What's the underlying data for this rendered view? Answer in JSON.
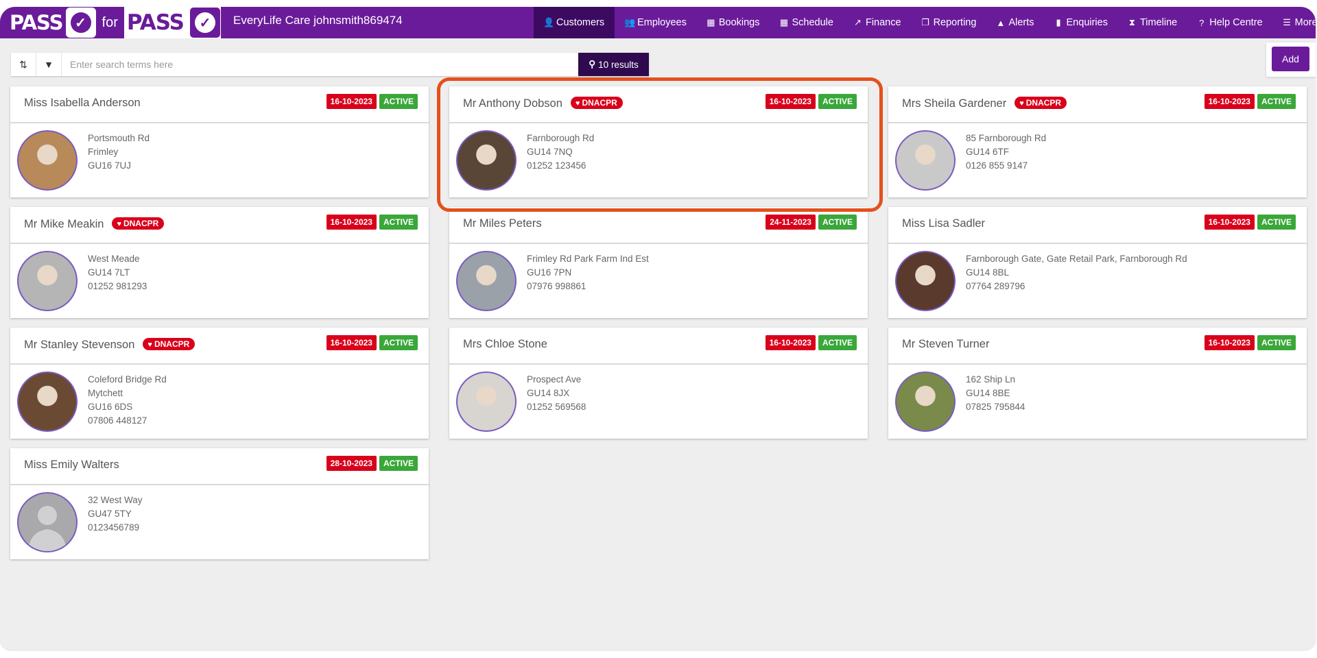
{
  "app": {
    "logo_left": "PASS",
    "logo_for": "for",
    "logo_right": "PASS",
    "organisation": "EveryLife Care johnsmith869474"
  },
  "nav": {
    "items": [
      {
        "label": "Customers",
        "icon": "user-icon",
        "glyph": "👤",
        "active": true
      },
      {
        "label": "Employees",
        "icon": "users-icon",
        "glyph": "👥",
        "active": false
      },
      {
        "label": "Bookings",
        "icon": "calendar-icon",
        "glyph": "▦",
        "active": false
      },
      {
        "label": "Schedule",
        "icon": "calendar-icon",
        "glyph": "▦",
        "active": false
      },
      {
        "label": "Finance",
        "icon": "line-chart-icon",
        "glyph": "↗",
        "active": false
      },
      {
        "label": "Reporting",
        "icon": "copy-icon",
        "glyph": "❐",
        "active": false
      },
      {
        "label": "Alerts",
        "icon": "warning-icon",
        "glyph": "▲",
        "active": false
      },
      {
        "label": "Enquiries",
        "icon": "document-icon",
        "glyph": "▮",
        "active": false
      },
      {
        "label": "Timeline",
        "icon": "hourglass-icon",
        "glyph": "⧗",
        "active": false
      },
      {
        "label": "Help Centre",
        "icon": "help-icon",
        "glyph": "?",
        "active": false
      },
      {
        "label": "More",
        "icon": "menu-icon",
        "glyph": "☰",
        "active": false
      }
    ]
  },
  "search": {
    "placeholder": "Enter search terms here",
    "value": "",
    "sort_icon": "sort-icon",
    "filter_icon": "filter-icon",
    "results_label": "10 results"
  },
  "actions": {
    "add_label": "Add"
  },
  "colors": {
    "brand": "#6a1b9a",
    "nav_active": "#3d0a62",
    "results_button": "#2f0a4f",
    "date_badge": "#d9001b",
    "active_badge": "#3aa73a",
    "dnacpr_badge": "#d9001b",
    "highlight": "#e4501c"
  },
  "customers": [
    {
      "name": "Miss Isabella Anderson",
      "dnacpr": false,
      "date": "16-10-2023",
      "status": "ACTIVE",
      "address": [
        "Portsmouth Rd",
        "Frimley",
        "GU16 7UJ"
      ],
      "highlighted": false
    },
    {
      "name": "Mr Anthony Dobson",
      "dnacpr": true,
      "date": "16-10-2023",
      "status": "ACTIVE",
      "address": [
        "Farnborough Rd",
        "GU14 7NQ",
        "01252 123456"
      ],
      "highlighted": true
    },
    {
      "name": "Mrs Sheila Gardener",
      "dnacpr": true,
      "date": "16-10-2023",
      "status": "ACTIVE",
      "address": [
        "85 Farnborough Rd",
        "GU14 6TF",
        "0126 855 9147"
      ],
      "highlighted": false
    },
    {
      "name": "Mr Mike Meakin",
      "dnacpr": true,
      "date": "16-10-2023",
      "status": "ACTIVE",
      "address": [
        "West Meade",
        "GU14 7LT",
        "01252 981293"
      ],
      "highlighted": false
    },
    {
      "name": "Mr Miles Peters",
      "dnacpr": false,
      "date": "24-11-2023",
      "status": "ACTIVE",
      "address": [
        "Frimley Rd Park Farm Ind Est",
        "GU16 7PN",
        "07976 998861"
      ],
      "highlighted": false
    },
    {
      "name": "Miss Lisa Sadler",
      "dnacpr": false,
      "date": "16-10-2023",
      "status": "ACTIVE",
      "address": [
        "Farnborough Gate, Gate Retail Park, Farnborough Rd",
        "GU14 8BL",
        "07764 289796"
      ],
      "highlighted": false
    },
    {
      "name": "Mr Stanley Stevenson",
      "dnacpr": true,
      "date": "16-10-2023",
      "status": "ACTIVE",
      "address": [
        "Coleford Bridge Rd",
        "Mytchett",
        "GU16 6DS",
        "07806 448127"
      ],
      "highlighted": false
    },
    {
      "name": "Mrs Chloe Stone",
      "dnacpr": false,
      "date": "16-10-2023",
      "status": "ACTIVE",
      "address": [
        "Prospect Ave",
        "GU14 8JX",
        "01252 569568"
      ],
      "highlighted": false
    },
    {
      "name": "Mr Steven Turner",
      "dnacpr": false,
      "date": "16-10-2023",
      "status": "ACTIVE",
      "address": [
        "162 Ship Ln",
        "GU14 8BE",
        "07825 795844"
      ],
      "highlighted": false
    },
    {
      "name": "Miss Emily Walters",
      "dnacpr": false,
      "date": "28-10-2023",
      "status": "ACTIVE",
      "address": [
        "32 West Way",
        "GU47 5TY",
        "0123456789"
      ],
      "highlighted": false,
      "placeholder_avatar": true
    }
  ],
  "badge_text": {
    "dnacpr": "DNACPR"
  }
}
